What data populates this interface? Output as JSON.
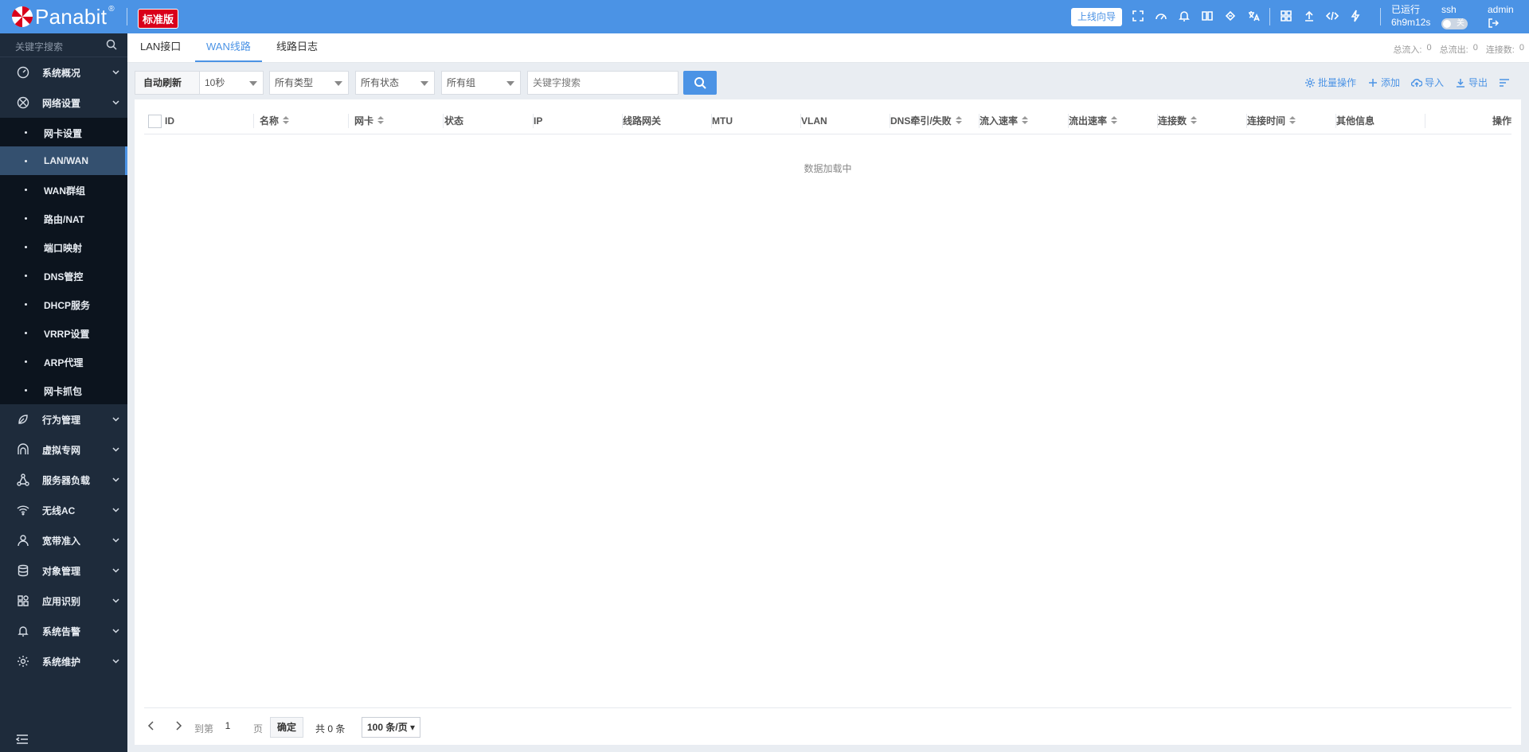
{
  "header": {
    "brand": "Panabit",
    "brand_mark": "®",
    "edition": "标准版",
    "wizard_label": "上线向导",
    "icons": [
      "fullscreen-icon",
      "dashboard-icon",
      "bell-icon",
      "book-icon",
      "thumbs-icon",
      "translate-icon",
      "apps-icon",
      "upload-icon",
      "code-icon",
      "lightning-icon"
    ],
    "runtime_label": "已运行",
    "runtime_value": "6h9m12s",
    "ssh_label": "ssh",
    "ssh_toggle": "关",
    "user": "admin",
    "colors": {
      "bar": "#4b93e5",
      "edition": "#d9001b"
    }
  },
  "sidebar": {
    "search_placeholder": "关键字搜索",
    "items": [
      {
        "label": "系统概况",
        "icon": "gauge-icon"
      },
      {
        "label": "网络设置",
        "icon": "network-icon",
        "expanded": true,
        "children": [
          "网卡设置",
          "LAN/WAN",
          "WAN群组",
          "路由/NAT",
          "端口映射",
          "DNS管控",
          "DHCP服务",
          "VRRP设置",
          "ARP代理",
          "网卡抓包"
        ],
        "active_child": "LAN/WAN"
      },
      {
        "label": "行为管理",
        "icon": "leaf-icon"
      },
      {
        "label": "虚拟专网",
        "icon": "vpn-icon"
      },
      {
        "label": "服务器负载",
        "icon": "cluster-icon"
      },
      {
        "label": "无线AC",
        "icon": "wifi-icon"
      },
      {
        "label": "宽带准入",
        "icon": "user-icon"
      },
      {
        "label": "对象管理",
        "icon": "database-icon"
      },
      {
        "label": "应用识别",
        "icon": "apps-icon"
      },
      {
        "label": "系统告警",
        "icon": "bell-icon"
      },
      {
        "label": "系统维护",
        "icon": "gear-icon"
      }
    ]
  },
  "tabs": [
    {
      "label": "LAN接口",
      "active": false
    },
    {
      "label": "WAN线路",
      "active": true
    },
    {
      "label": "线路日志",
      "active": false
    }
  ],
  "stats": {
    "in_label": "总流入:",
    "in_value": "0",
    "out_label": "总流出:",
    "out_value": "0",
    "conn_label": "连接数:",
    "conn_value": "0"
  },
  "toolbar": {
    "auto_refresh": "自动刷新",
    "interval": "10秒",
    "type_filter": "所有类型",
    "status_filter": "所有状态",
    "group_filter": "所有组",
    "search_placeholder": "关键字搜索"
  },
  "actions": {
    "batch": "批量操作",
    "add": "添加",
    "import": "导入",
    "export": "导出"
  },
  "table": {
    "columns": [
      "ID",
      "名称",
      "网卡",
      "状态",
      "IP",
      "线路网关",
      "MTU",
      "VLAN",
      "DNS牵引/失败",
      "流入速率",
      "流出速率",
      "连接数",
      "连接时间",
      "其他信息",
      "操作"
    ],
    "sortable": [
      false,
      true,
      true,
      false,
      false,
      false,
      false,
      false,
      true,
      true,
      true,
      true,
      true,
      false,
      false
    ],
    "loading": "数据加载中"
  },
  "pager": {
    "goto_label": "到第",
    "page": "1",
    "page_unit": "页",
    "confirm": "确定",
    "total": "共 0 条",
    "page_size": "100 条/页"
  }
}
